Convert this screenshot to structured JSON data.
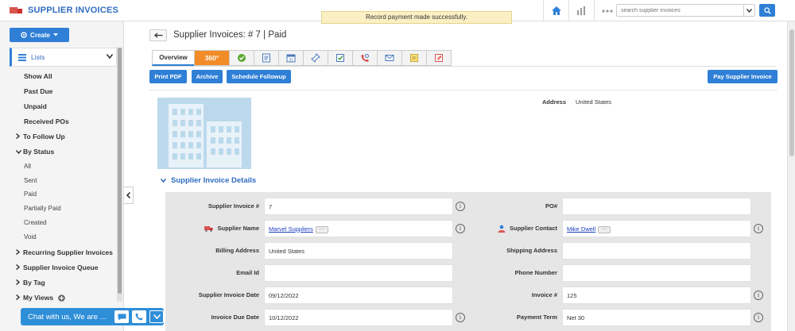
{
  "app": {
    "title": "SUPPLIER INVOICES"
  },
  "toast": {
    "message": "Record payment made successfully."
  },
  "search": {
    "placeholder": "search supplier invoices"
  },
  "sidebar": {
    "create_label": "Create",
    "lists_label": "Lists",
    "items": [
      {
        "label": "Show All"
      },
      {
        "label": "Past Due"
      },
      {
        "label": "Unpaid"
      },
      {
        "label": "Received POs"
      },
      {
        "label": "To Follow Up"
      },
      {
        "label": "By Status"
      },
      {
        "label": "All"
      },
      {
        "label": "Sent"
      },
      {
        "label": "Paid"
      },
      {
        "label": "Partially Paid"
      },
      {
        "label": "Created"
      },
      {
        "label": "Void"
      },
      {
        "label": "Recurring Supplier Invoices"
      },
      {
        "label": "Supplier Invoice Queue"
      },
      {
        "label": "By Tag"
      },
      {
        "label": "My Views"
      }
    ]
  },
  "chat": {
    "label": "Chat with us, We are ..."
  },
  "main": {
    "title": "Supplier Invoices: # 7 | Paid",
    "tabs": {
      "overview": "Overview",
      "t360": "360°"
    },
    "actions": {
      "print_pdf": "Print PDF",
      "archive": "Archive",
      "schedule_followup": "Schedule Followup",
      "pay": "Pay Supplier Invoice"
    },
    "address_label": "Address",
    "address_value": "United States",
    "section_title": "Supplier Invoice Details"
  },
  "details": {
    "left": [
      {
        "label": "Supplier Invoice #",
        "value": "7"
      },
      {
        "label": "Supplier Name",
        "value": "Marvel Suppliers"
      },
      {
        "label": "Billing Address",
        "value": "United States"
      },
      {
        "label": "Email Id",
        "value": ""
      },
      {
        "label": "Supplier Invoice Date",
        "value": "09/12/2022"
      },
      {
        "label": "Invoice Due Date",
        "value": "10/12/2022"
      }
    ],
    "right": [
      {
        "label": "PO#",
        "value": ""
      },
      {
        "label": "Supplier Contact",
        "value": "Mike Dwell"
      },
      {
        "label": "Shipping Address",
        "value": ""
      },
      {
        "label": "Phone Number",
        "value": ""
      },
      {
        "label": "Invoice #",
        "value": "125"
      },
      {
        "label": "Payment Term",
        "value": "Net 30"
      }
    ]
  },
  "colors": {
    "accent": "#2f7fd6",
    "title": "#2f6dc1",
    "tab360": "#f28c28",
    "toast_bg": "#fbf0c4"
  }
}
